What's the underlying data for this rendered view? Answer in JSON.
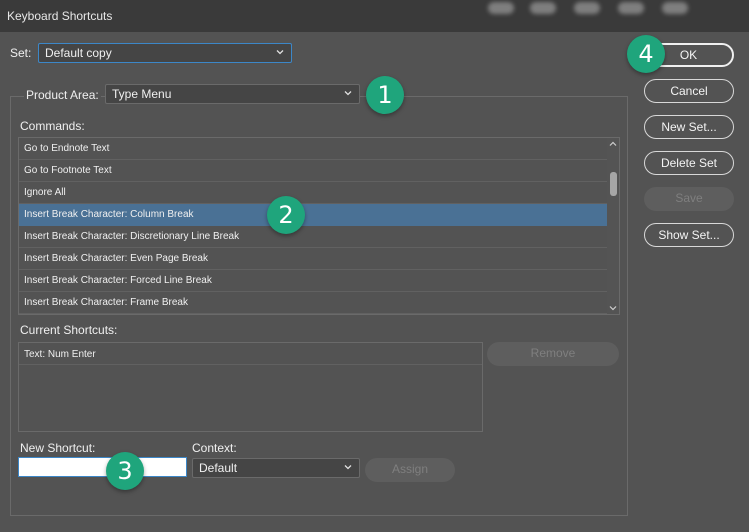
{
  "window": {
    "title": "Keyboard Shortcuts"
  },
  "set": {
    "label": "Set:",
    "value": "Default copy"
  },
  "product_area": {
    "label": "Product Area:",
    "value": "Type Menu"
  },
  "commands": {
    "label": "Commands:",
    "items": [
      {
        "label": "Go to Endnote Text"
      },
      {
        "label": "Go to Footnote Text"
      },
      {
        "label": "Ignore All"
      },
      {
        "label": "Insert Break Character: Column Break",
        "selected": true
      },
      {
        "label": "Insert Break Character: Discretionary Line Break"
      },
      {
        "label": "Insert Break Character: Even Page Break"
      },
      {
        "label": "Insert Break Character: Forced Line Break"
      },
      {
        "label": "Insert Break Character: Frame Break"
      }
    ]
  },
  "current_shortcuts": {
    "label": "Current Shortcuts:",
    "items": [
      {
        "label": "Text: Num Enter"
      }
    ],
    "remove_label": "Remove"
  },
  "new_shortcut": {
    "label": "New Shortcut:",
    "value": ""
  },
  "context": {
    "label": "Context:",
    "value": "Default"
  },
  "assign_label": "Assign",
  "buttons": {
    "ok": "OK",
    "cancel": "Cancel",
    "new_set": "New Set...",
    "delete_set": "Delete Set",
    "save": "Save",
    "show_set": "Show Set..."
  },
  "badges": [
    "1",
    "2",
    "3",
    "4"
  ],
  "colors": {
    "background": "#535353",
    "selection": "#4a7195",
    "focus_border": "#3c87c8",
    "badge": "#1fa57c"
  },
  "icons": [
    "chevron-down-icon",
    "scroll-up-arrow-icon",
    "scroll-down-arrow-icon"
  ]
}
